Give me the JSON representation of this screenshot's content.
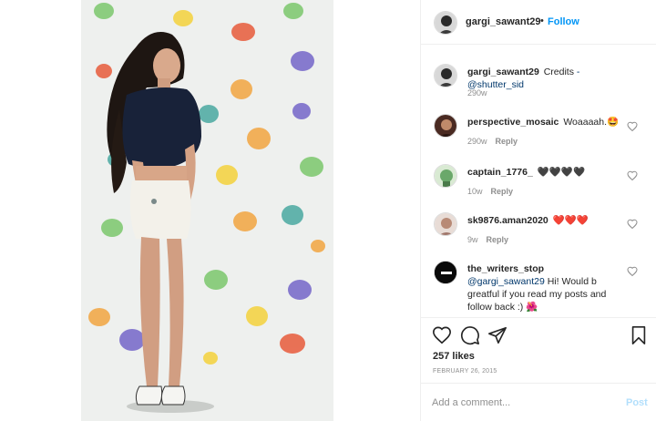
{
  "post": {
    "author": "gargi_sawant29",
    "separator": "•",
    "follow_label": "Follow"
  },
  "comments": [
    {
      "username": "gargi_sawant29",
      "text": "Credits",
      "mention": "-@shutter_sid",
      "time": "290w",
      "reply": ""
    },
    {
      "username": "perspective_mosaic",
      "text": "Woaaaah.🤩",
      "time": "290w",
      "reply": "Reply"
    },
    {
      "username": "captain_1776_",
      "text": "🖤🖤🖤🖤",
      "time": "10w",
      "reply": "Reply"
    },
    {
      "username": "sk9876.aman2020",
      "text": "❤️❤️❤️",
      "time": "9w",
      "reply": "Reply"
    },
    {
      "username": "the_writers_stop",
      "mention": "@gargi_sawant29",
      "text": "Hi! Would b greatful if you read my posts and follow back :) 🌺"
    }
  ],
  "actions": {
    "likes": "257 likes",
    "date": "FEBRUARY 26, 2015"
  },
  "add_comment": {
    "placeholder": "Add a comment...",
    "post_label": "Post"
  },
  "icons": {
    "like": "heart-icon",
    "comment": "comment-bubble-icon",
    "share": "paper-plane-icon",
    "save": "bookmark-icon"
  },
  "colors": {
    "link": "#0095f6",
    "mention": "#00376b",
    "muted": "#8e8e8e"
  }
}
